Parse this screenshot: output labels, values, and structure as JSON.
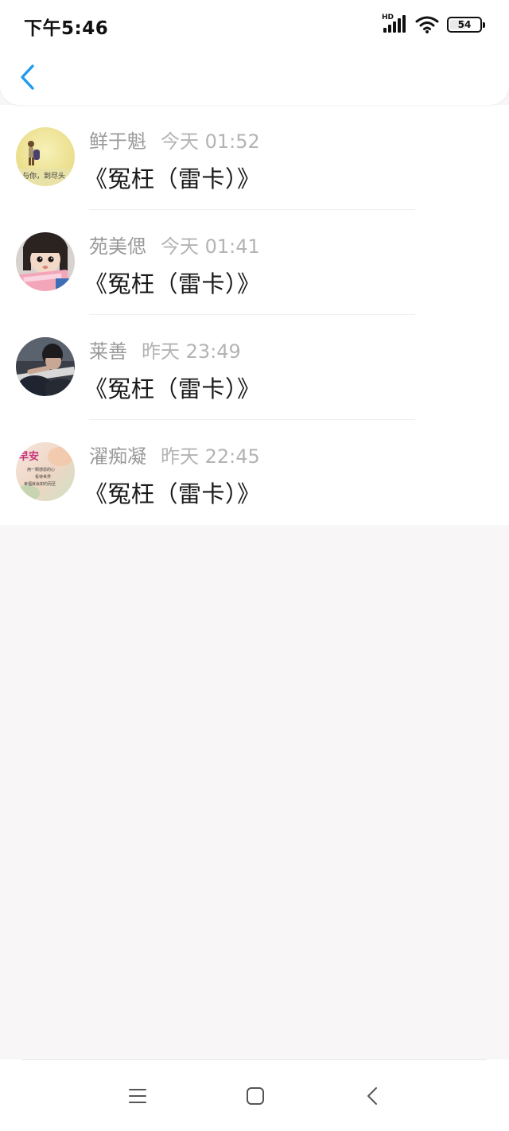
{
  "status_bar": {
    "time": "下午5:46",
    "network_label": "HD",
    "battery_level": "54",
    "battery_fraction": 0.54,
    "icons": [
      "hd-signal-icon",
      "wifi-icon",
      "battery-icon"
    ]
  },
  "header": {
    "back_icon": "chevron-left-icon",
    "accent_color": "#1e9bf0"
  },
  "messages": [
    {
      "name": "鲜于魁",
      "time": "今天 01:52",
      "title": "《冤枉（雷卡）》",
      "avatar": "avatar-yellow-girl"
    },
    {
      "name": "苑美偲",
      "time": "今天 01:41",
      "title": "《冤枉（雷卡）》",
      "avatar": "avatar-child"
    },
    {
      "name": "莱善",
      "time": "昨天 23:49",
      "title": "《冤枉（雷卡）》",
      "avatar": "avatar-dark-photo"
    },
    {
      "name": "濯痴凝",
      "time": "昨天 22:45",
      "title": "《冤枉（雷卡）》",
      "avatar": "avatar-good-morning"
    }
  ],
  "avatar_text": {
    "yellow_girl": "与你，到尽头",
    "good_morning_title": "早安",
    "good_morning_line1": "用一颗感恩的心",
    "good_morning_line2": "看待世界",
    "good_morning_line3": "幸福就会如约而至"
  },
  "bottom_nav": {
    "icons": [
      "menu-icon",
      "home-square-icon",
      "back-triangle-icon"
    ]
  }
}
